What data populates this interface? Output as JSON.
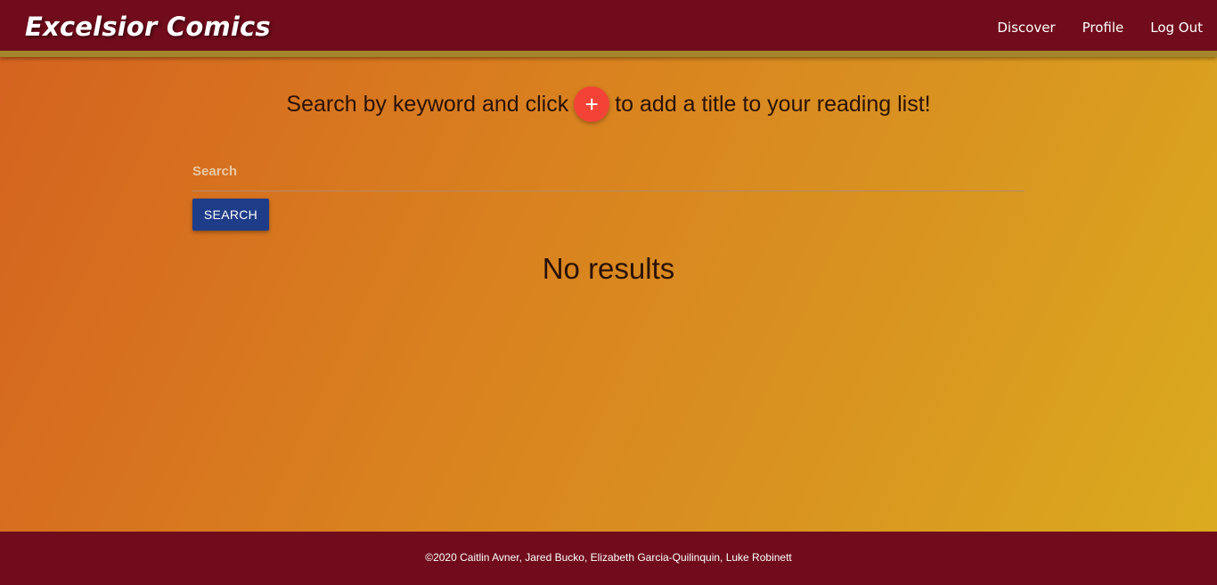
{
  "navbar": {
    "brand": "Excelsior Comics",
    "links": [
      "Discover",
      "Profile",
      "Log Out"
    ]
  },
  "main": {
    "instruction_before": "Search by keyword and click",
    "add_icon_glyph": "+",
    "instruction_after": "to add a title to your reading list!",
    "search": {
      "label": "Search",
      "value": ""
    },
    "search_button": "SEARCH",
    "no_results": "No results"
  },
  "footer": {
    "copyright": "©2020 Caitlin Avner, Jared Bucko, Elizabeth Garcia-Quilinquin, Luke Robinett"
  },
  "colors": {
    "navbar": "#700c1c",
    "navbar_accent": "#a3862a",
    "add_button": "#f44336",
    "search_button": "#1f3c88"
  }
}
